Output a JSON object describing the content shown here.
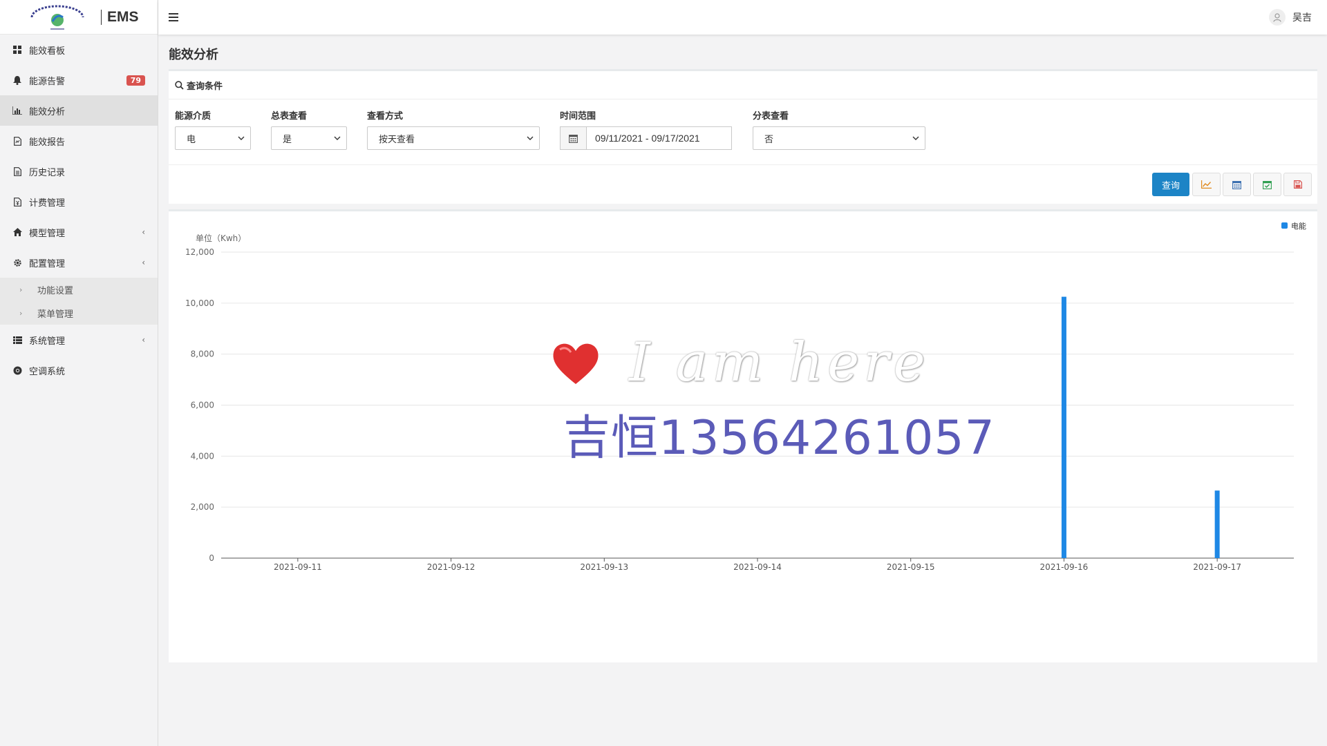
{
  "brand": {
    "name": "EMS",
    "logo_text": "上海吉恒气能源科技有限公司"
  },
  "sidebar": {
    "items": [
      {
        "label": "能效看板",
        "icon": "dashboard-grid-icon"
      },
      {
        "label": "能源告警",
        "icon": "bell-icon",
        "badge": "79"
      },
      {
        "label": "能效分析",
        "icon": "bar-chart-icon",
        "active": true
      },
      {
        "label": "能效报告",
        "icon": "report-file-icon"
      },
      {
        "label": "历史记录",
        "icon": "document-icon"
      },
      {
        "label": "计费管理",
        "icon": "billing-file-icon"
      },
      {
        "label": "模型管理",
        "icon": "home-icon",
        "has_children": true
      },
      {
        "label": "配置管理",
        "icon": "gear-icon",
        "has_children": true
      },
      {
        "label": "系统管理",
        "icon": "list-icon",
        "has_children": true
      },
      {
        "label": "空调系统",
        "icon": "chrome-icon"
      }
    ],
    "sub_items": [
      "功能设置",
      "菜单管理"
    ]
  },
  "topbar": {
    "user_name": "吴吉"
  },
  "page": {
    "title": "能效分析"
  },
  "query": {
    "header": "查询条件",
    "fields": [
      {
        "label": "能源介质",
        "value": "电"
      },
      {
        "label": "总表查看",
        "value": "是"
      },
      {
        "label": "查看方式",
        "value": "按天查看"
      },
      {
        "label": "时间范围",
        "value": "09/11/2021 - 09/17/2021"
      },
      {
        "label": "分表查看",
        "value": "否"
      }
    ],
    "search_button": "查询"
  },
  "colors": {
    "primary": "#1c84c6",
    "bar": "#1e88e5",
    "badge": "#d9534f"
  },
  "watermark": {
    "script": "I am here",
    "text": "吉恒13564261057"
  },
  "chart_data": {
    "type": "bar",
    "ylabel": "单位（Kwh）",
    "ylim": [
      0,
      12000
    ],
    "yticks": [
      0,
      2000,
      4000,
      6000,
      8000,
      10000,
      12000
    ],
    "ytick_labels": [
      "0",
      "2,000",
      "4,000",
      "6,000",
      "8,000",
      "10,000",
      "12,000"
    ],
    "categories": [
      "2021-09-11",
      "2021-09-12",
      "2021-09-13",
      "2021-09-14",
      "2021-09-15",
      "2021-09-16",
      "2021-09-17"
    ],
    "series": [
      {
        "name": "电能",
        "values": [
          0,
          0,
          0,
          0,
          0,
          10250,
          2650
        ]
      }
    ],
    "legend": "top-right",
    "grid": true
  }
}
